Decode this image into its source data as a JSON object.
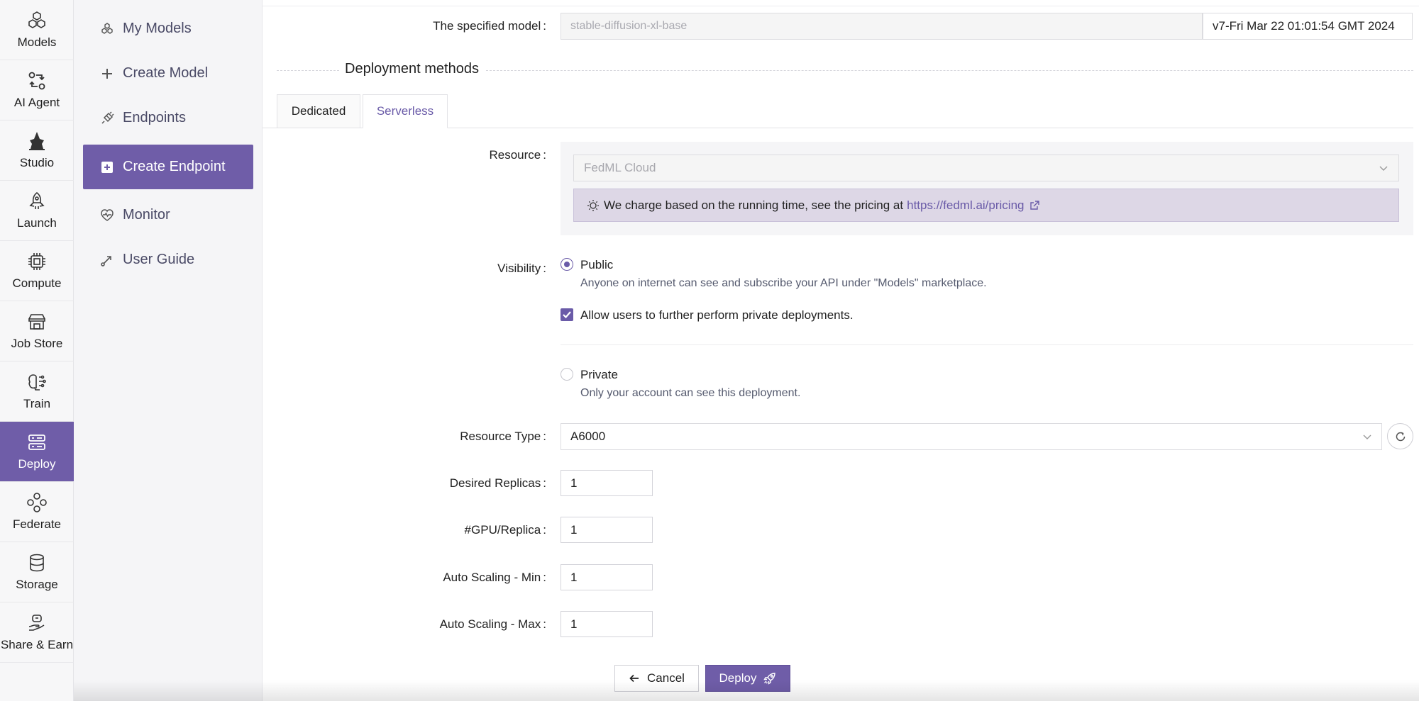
{
  "rail": [
    {
      "label": "Models",
      "icon": "models-icon"
    },
    {
      "label": "AI Agent",
      "icon": "ai-agent-icon"
    },
    {
      "label": "Studio",
      "icon": "studio-icon"
    },
    {
      "label": "Launch",
      "icon": "rocket-icon"
    },
    {
      "label": "Compute",
      "icon": "chip-icon"
    },
    {
      "label": "Job Store",
      "icon": "store-icon"
    },
    {
      "label": "Train",
      "icon": "brain-icon"
    },
    {
      "label": "Deploy",
      "icon": "deploy-icon",
      "active": true
    },
    {
      "label": "Federate",
      "icon": "federate-icon"
    },
    {
      "label": "Storage",
      "icon": "database-icon"
    },
    {
      "label": "Share & Earn",
      "icon": "share-earn-icon"
    }
  ],
  "subnav": [
    {
      "label": "My Models",
      "icon": "models-icon"
    },
    {
      "label": "Create Model",
      "icon": "plus-icon"
    },
    {
      "label": "Endpoints",
      "icon": "plug-icon"
    },
    {
      "label": "Create Endpoint",
      "icon": "plus-square-icon",
      "active": true
    },
    {
      "label": "Monitor",
      "icon": "heart-monitor-icon"
    },
    {
      "label": "User Guide",
      "icon": "guide-icon"
    }
  ],
  "form": {
    "model_label": "The specified model",
    "model_value": "stable-diffusion-xl-base",
    "model_version": "v7-Fri Mar 22 01:01:54 GMT 2024",
    "section_title": "Deployment methods",
    "tabs": [
      {
        "label": "Dedicated"
      },
      {
        "label": "Serverless",
        "active": true
      }
    ],
    "resource_label": "Resource",
    "resource_value": "FedML Cloud",
    "notice_text": "We charge based on the running time, see the pricing at",
    "notice_link": "https://fedml.ai/pricing",
    "visibility_label": "Visibility",
    "public_title": "Public",
    "public_desc": "Anyone on internet can see and subscribe your API under \"Models\" marketplace.",
    "allow_private": "Allow users to further perform private deployments.",
    "private_title": "Private",
    "private_desc": "Only your account can see this deployment.",
    "resource_type_label": "Resource Type",
    "resource_type_value": "A6000",
    "replicas_label": "Desired Replicas",
    "replicas_value": "1",
    "gpu_label": "#GPU/Replica",
    "gpu_value": "1",
    "scale_min_label": "Auto Scaling - Min",
    "scale_min_value": "1",
    "scale_max_label": "Auto Scaling - Max",
    "scale_max_value": "1",
    "cancel_label": "Cancel",
    "deploy_label": "Deploy"
  },
  "colors": {
    "accent": "#6f5da8",
    "notice_bg": "#ddd7e6"
  }
}
